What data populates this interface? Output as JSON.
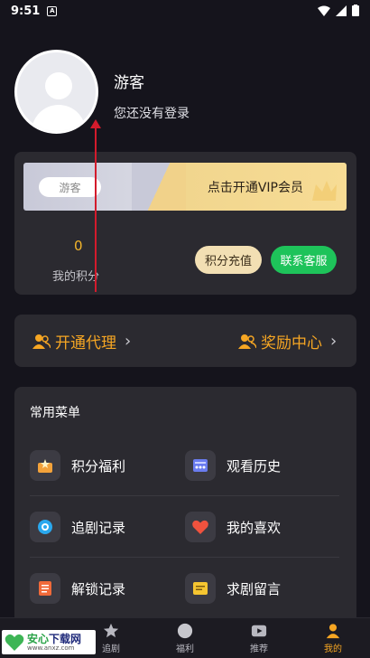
{
  "status_bar": {
    "time": "9:51",
    "notification_glyph": "A"
  },
  "profile": {
    "username": "游客",
    "subtitle": "您还没有登录"
  },
  "vip_card": {
    "guest_tag": "游客",
    "vip_text": "点击开通VIP会员",
    "points_value": "0",
    "points_label": "我的积分",
    "recharge_button": "积分充值",
    "service_button": "联系客服"
  },
  "agent_row": {
    "agent_label": "开通代理",
    "reward_label": "奖励中心"
  },
  "menu": {
    "title": "常用菜单",
    "items": [
      {
        "label": "积分福利",
        "icon": "gift-icon"
      },
      {
        "label": "观看历史",
        "icon": "history-icon"
      },
      {
        "label": "追剧记录",
        "icon": "record-icon"
      },
      {
        "label": "我的喜欢",
        "icon": "heart-icon"
      },
      {
        "label": "解锁记录",
        "icon": "unlock-icon"
      },
      {
        "label": "求剧留言",
        "icon": "message-icon"
      }
    ]
  },
  "tabs": [
    {
      "label": "追剧",
      "icon": "star-icon"
    },
    {
      "label": "福利",
      "icon": "welfare-icon"
    },
    {
      "label": "推荐",
      "icon": "play-icon"
    },
    {
      "label": "我的",
      "icon": "profile-icon",
      "active": true
    }
  ],
  "watermark": {
    "brand_green": "安心",
    "brand_blue": "下载网",
    "url": "www.anxz.com"
  },
  "colors": {
    "accent": "#f6a623",
    "green": "#1ec35a",
    "card": "#2b2a30",
    "bg": "#15141c",
    "arrow": "#d31b2c"
  }
}
